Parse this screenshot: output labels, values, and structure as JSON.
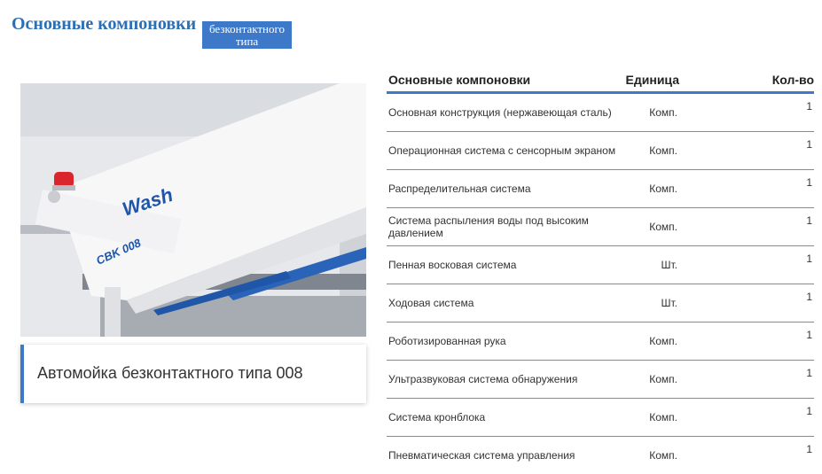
{
  "header": {
    "title": "Основные компоновки",
    "badge": "безконтактного типа"
  },
  "product": {
    "card_title": "Автомойка безконтактного типа 008",
    "photo_brand_text": "Wash",
    "photo_model_text": "CBK 008"
  },
  "table": {
    "headers": {
      "component": "Основные компоновки",
      "unit": "Единица",
      "qty": "Кол-во"
    },
    "rows": [
      {
        "component": "Основная конструкция (нержавеющая сталь)",
        "unit": "Комп.",
        "qty": "1"
      },
      {
        "component": "Операционная система с сенсорным экраном",
        "unit": "Комп.",
        "qty": "1"
      },
      {
        "component": "Распределительная система",
        "unit": "Комп.",
        "qty": "1"
      },
      {
        "component": "Система распыления воды под высоким давлением",
        "unit": "Комп.",
        "qty": "1"
      },
      {
        "component": "Пенная восковая система",
        "unit": "Шт.",
        "qty": "1"
      },
      {
        "component": "Ходовая система",
        "unit": "Шт.",
        "qty": "1"
      },
      {
        "component": "Роботизированная рука",
        "unit": "Комп.",
        "qty": "1"
      },
      {
        "component": "Ультразвуковая система обнаружения",
        "unit": "Комп.",
        "qty": "1"
      },
      {
        "component": "Система кронблока",
        "unit": "Комп.",
        "qty": "1"
      },
      {
        "component": "Пневматическая система управления",
        "unit": "Комп.",
        "qty": "1"
      }
    ]
  },
  "colors": {
    "accent": "#3d78c9",
    "title": "#2c6fb3"
  }
}
